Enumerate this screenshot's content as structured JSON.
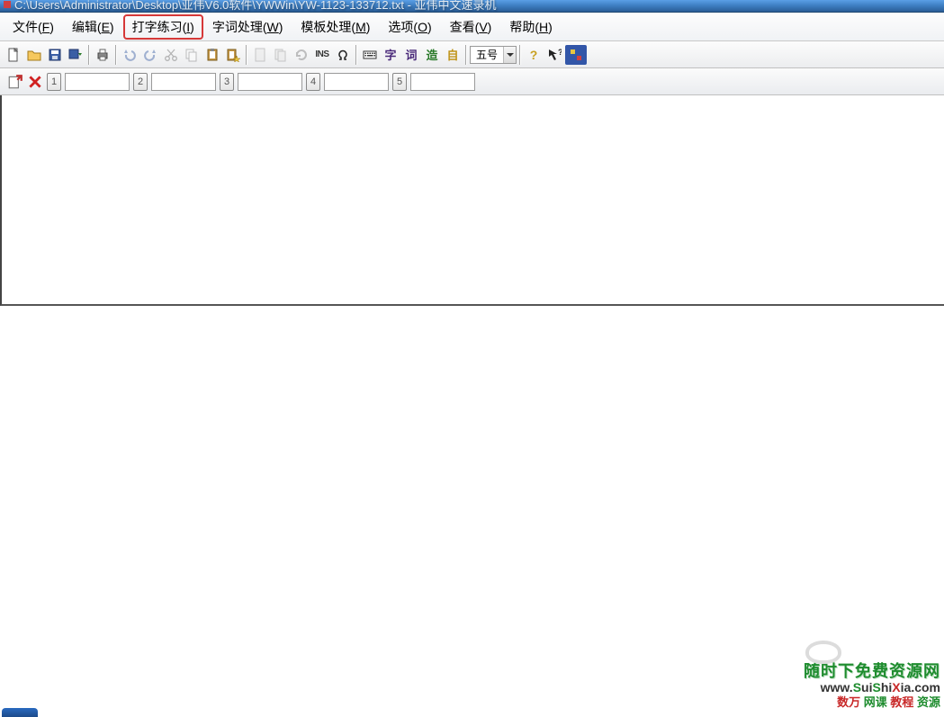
{
  "title": "C:\\Users\\Administrator\\Desktop\\亚伟V6.0软件\\YWWin\\YW-1123-133712.txt - 亚伟中文速录机",
  "menu": {
    "file": {
      "pre": "文件(",
      "u": "F",
      "post": ")"
    },
    "edit": {
      "pre": "编辑(",
      "u": "E",
      "post": ")"
    },
    "typing": {
      "pre": "打字练习(",
      "u": "I",
      "post": ")"
    },
    "word": {
      "pre": "字词处理(",
      "u": "W",
      "post": ")"
    },
    "tmpl": {
      "pre": "模板处理(",
      "u": "M",
      "post": ")"
    },
    "opt": {
      "pre": "选项(",
      "u": "O",
      "post": ")"
    },
    "view": {
      "pre": "查看(",
      "u": "V",
      "post": ")"
    },
    "help": {
      "pre": "帮助(",
      "u": "H",
      "post": ")"
    }
  },
  "toolbar": {
    "ins": "INS",
    "zi": "字",
    "ci": "词",
    "zao": "造",
    "auto": "自",
    "size": "五号"
  },
  "candidates": [
    "1",
    "2",
    "3",
    "4",
    "5"
  ],
  "watermark": {
    "line1": "随时下免费资源网",
    "l2_www": "www.",
    "l2_s": "S",
    "l2_ui": "ui",
    "l2_sx": "S",
    "l2_hi": "hi",
    "l2_x": "X",
    "l2_ia": "ia",
    "l2_com": ".com",
    "l3a": "数万 ",
    "l3b": "网课 ",
    "l3c": "教程 ",
    "l3d": "资源"
  },
  "colors": {
    "highlight": "#d63838",
    "brandGreen": "#1e8c2e",
    "brandRed": "#c82828"
  }
}
